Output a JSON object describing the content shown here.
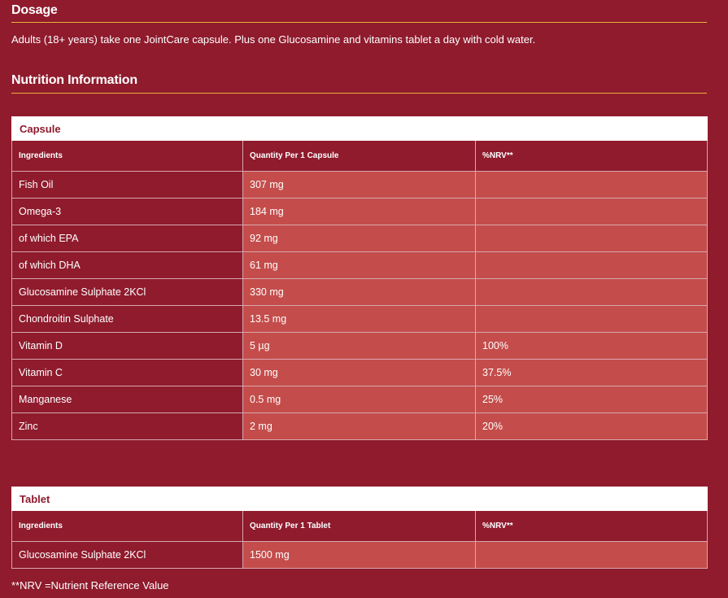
{
  "dosage": {
    "heading": "Dosage",
    "text": "Adults (18+ years) take one JointCare capsule. Plus one Glucosamine and vitamins tablet a day with cold water."
  },
  "nutrition": {
    "heading": "Nutrition Information"
  },
  "capsule_table": {
    "caption": "Capsule",
    "headers": [
      "Ingredients",
      "Quantity Per 1 Capsule",
      "%NRV**"
    ],
    "rows": [
      {
        "ingredient": "Fish Oil",
        "quantity": "307 mg",
        "nrv": ""
      },
      {
        "ingredient": "Omega-3",
        "quantity": "184 mg",
        "nrv": ""
      },
      {
        "ingredient": "of which EPA",
        "quantity": "92 mg",
        "nrv": ""
      },
      {
        "ingredient": "of which DHA",
        "quantity": "61 mg",
        "nrv": ""
      },
      {
        "ingredient": "Glucosamine Sulphate 2KCl",
        "quantity": "330 mg",
        "nrv": ""
      },
      {
        "ingredient": "Chondroitin Sulphate",
        "quantity": "13.5 mg",
        "nrv": ""
      },
      {
        "ingredient": "Vitamin D",
        "quantity": "5 µg",
        "nrv": "100%"
      },
      {
        "ingredient": "Vitamin C",
        "quantity": "30 mg",
        "nrv": "37.5%"
      },
      {
        "ingredient": "Manganese",
        "quantity": "0.5 mg",
        "nrv": "25%"
      },
      {
        "ingredient": "Zinc",
        "quantity": "2 mg",
        "nrv": "20%"
      }
    ]
  },
  "tablet_table": {
    "caption": "Tablet",
    "headers": [
      "Ingredients",
      "Quantity Per 1 Tablet",
      "%NRV**"
    ],
    "rows": [
      {
        "ingredient": "Glucosamine Sulphate 2KCl",
        "quantity": "1500 mg",
        "nrv": ""
      }
    ]
  },
  "footnote": "**NRV =Nutrient Reference Value",
  "colors": {
    "background": "#8f1b2d",
    "cell_accent": "#c44d4b",
    "rule": "#e8b33a",
    "caption_bg": "#ffffff"
  }
}
